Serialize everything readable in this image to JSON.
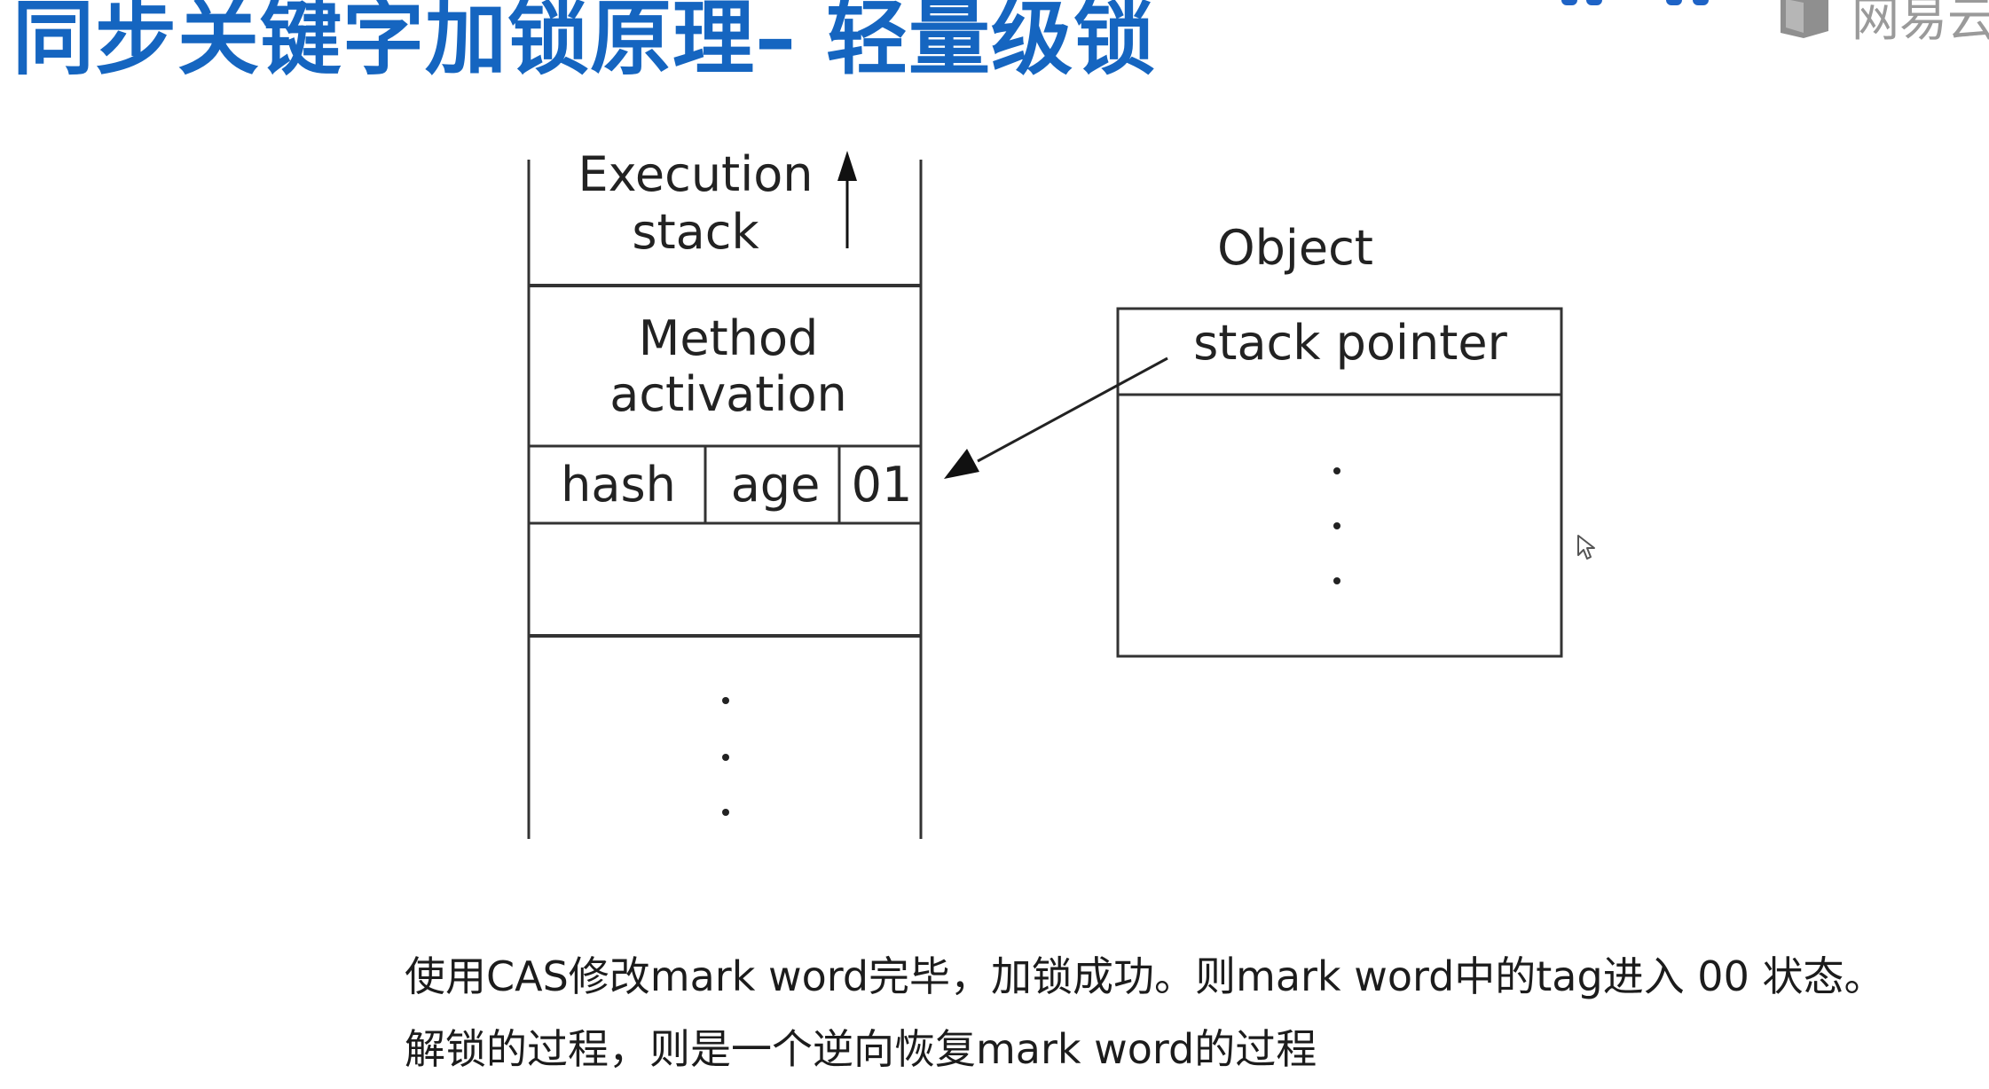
{
  "slide": {
    "title": "同步关键字加锁原理– 轻量级锁",
    "brand_label": "网易云"
  },
  "diagram": {
    "execution_stack_label": [
      "Execution",
      "stack"
    ],
    "method_activation_label": [
      "Method",
      "activation"
    ],
    "mark_word_fields": [
      "hash",
      "age",
      "01"
    ],
    "object_title": "Object",
    "object_field": "stack pointer"
  },
  "caption": {
    "line1": "使用CAS修改mark word完毕，加锁成功。则mark word中的tag进入 00 状态。",
    "line2": "解锁的过程，则是一个逆向恢复mark word的过程"
  },
  "colors": {
    "title": "#1565c0",
    "brand": "#9a9a9a",
    "line": "#333333"
  }
}
